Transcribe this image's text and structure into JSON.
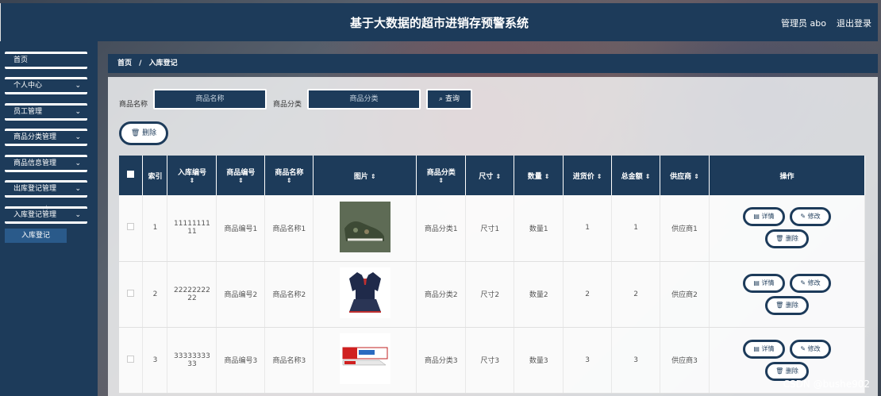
{
  "header": {
    "title": "基于大数据的超市进销存预警系统",
    "user": "管理员 abo",
    "logout": "退出登录"
  },
  "sidebar": {
    "items": [
      {
        "label": "首页",
        "has_chevron": false
      },
      {
        "label": "个人中心",
        "has_chevron": true
      },
      {
        "label": "员工管理",
        "has_chevron": true
      },
      {
        "label": "商品分类管理",
        "has_chevron": true
      },
      {
        "label": "商品信息管理",
        "has_chevron": true
      },
      {
        "label": "出库登记管理",
        "has_chevron": true
      },
      {
        "label": "入库登记管理",
        "has_chevron": true
      }
    ],
    "sub_item": "入库登记"
  },
  "breadcrumb": {
    "home": "首页",
    "sep": "/",
    "current": "入库登记"
  },
  "search": {
    "name_label": "商品名称",
    "name_placeholder": "商品名称",
    "category_label": "商品分类",
    "category_placeholder": "商品分类",
    "button": "查询"
  },
  "delete_button": "删除",
  "table": {
    "headers": [
      "",
      "索引",
      "入库编号",
      "商品编号",
      "商品名称",
      "图片",
      "商品分类",
      "尺寸",
      "数量",
      "进货价",
      "总金额",
      "供应商",
      "操作"
    ],
    "sortable": [
      false,
      false,
      true,
      true,
      true,
      true,
      true,
      true,
      true,
      true,
      true,
      true,
      false
    ],
    "rows": [
      {
        "index": "1",
        "code": "1111111111",
        "product_code": "商品编号1",
        "product_name": "商品名称1",
        "image": "shoes",
        "category": "商品分类1",
        "size": "尺寸1",
        "quantity": "数量1",
        "price": "1",
        "total": "1",
        "supplier": "供应商1"
      },
      {
        "index": "2",
        "code": "2222222222",
        "product_code": "商品编号2",
        "product_name": "商品名称2",
        "image": "uniform",
        "category": "商品分类2",
        "size": "尺寸2",
        "quantity": "数量2",
        "price": "2",
        "total": "2",
        "supplier": "供应商2"
      },
      {
        "index": "3",
        "code": "3333333333",
        "product_code": "商品编号3",
        "product_name": "商品名称3",
        "image": "toothpaste",
        "category": "商品分类3",
        "size": "尺寸3",
        "quantity": "数量3",
        "price": "3",
        "total": "3",
        "supplier": "供应商3"
      }
    ],
    "actions": {
      "detail": "详情",
      "edit": "修改",
      "delete": "删除"
    }
  },
  "watermark": "CSDN @bushe902"
}
